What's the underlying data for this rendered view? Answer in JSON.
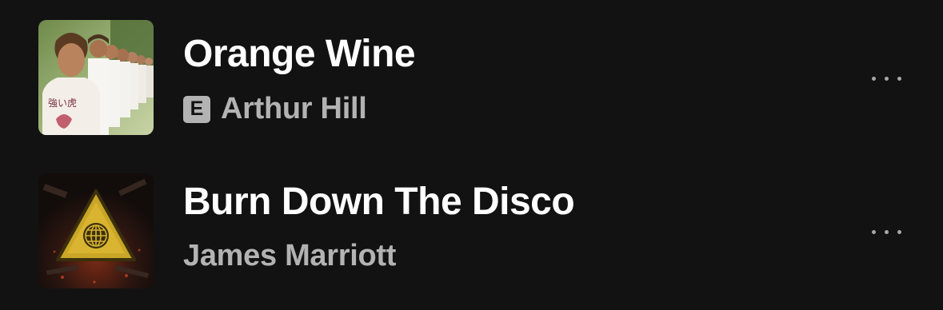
{
  "tracks": [
    {
      "title": "Orange Wine",
      "artist": "Arthur Hill",
      "explicit": true,
      "explicit_label": "E",
      "cover_art": "photo-of-band-lineup",
      "more_icon": "more-horizontal-icon"
    },
    {
      "title": "Burn Down The Disco",
      "artist": "James Marriott",
      "explicit": false,
      "cover_art": "warning-triangle-disco-ball",
      "more_icon": "more-horizontal-icon"
    }
  ],
  "colors": {
    "background": "#121212",
    "title": "#ffffff",
    "artist": "#b3b3b3",
    "explicit_badge": "#b3b3b3",
    "more_dots": "#a7a7a7"
  }
}
